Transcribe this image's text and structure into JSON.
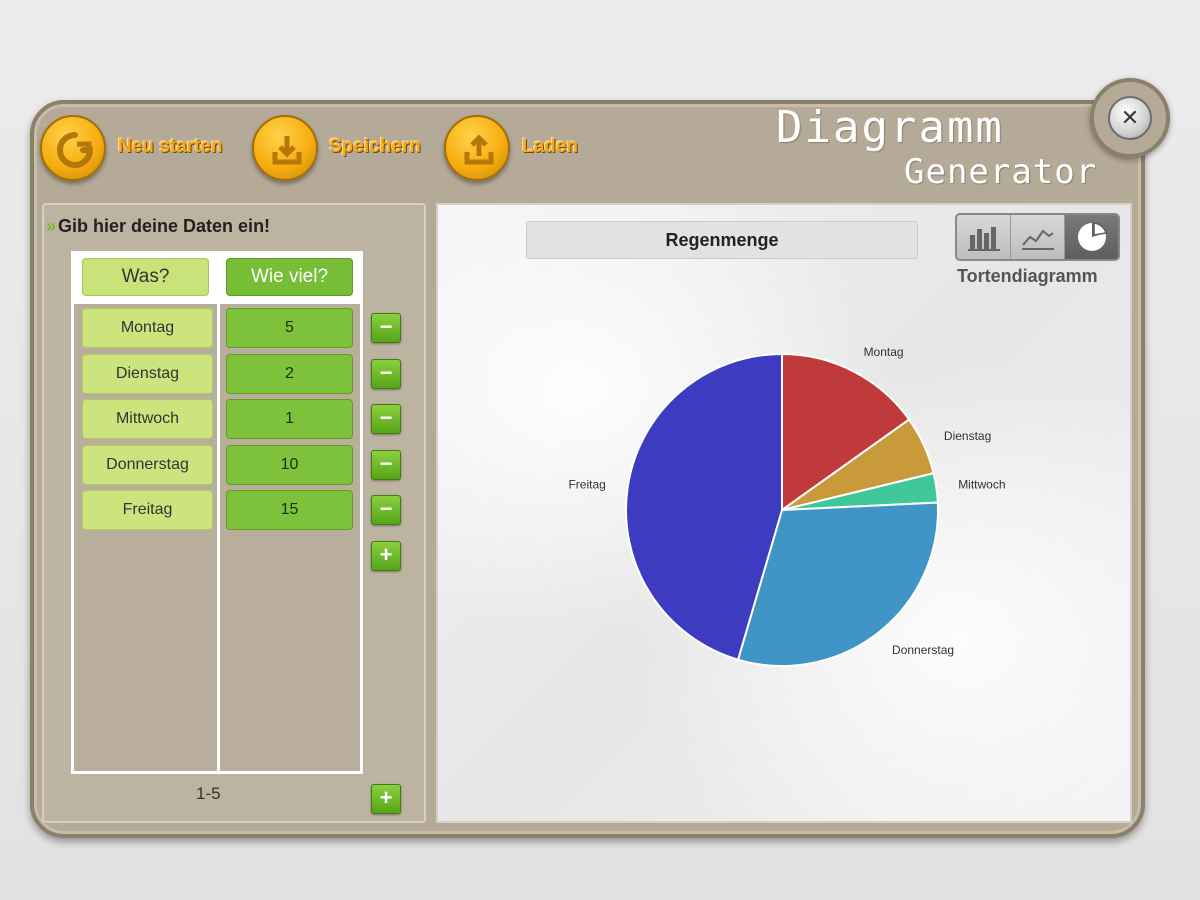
{
  "toolbar": {
    "restart_label": "Neu starten",
    "save_label": "Speichern",
    "load_label": "Laden",
    "close_symbol": "✕"
  },
  "app": {
    "title": "Diagramm",
    "subtitle": "Generator"
  },
  "data_panel": {
    "instruction": "Gib hier deine Daten ein!",
    "instruction_arrow": "»",
    "col_what": "Was?",
    "col_howmuch": "Wie viel?",
    "rows": [
      {
        "what": "Montag",
        "value": "5"
      },
      {
        "what": "Dienstag",
        "value": "2"
      },
      {
        "what": "Mittwoch",
        "value": "1"
      },
      {
        "what": "Donnerstag",
        "value": "10"
      },
      {
        "what": "Freitag",
        "value": "15"
      }
    ],
    "remove_symbol": "−",
    "add_symbol": "+",
    "pager": "1-5"
  },
  "chart_panel": {
    "title": "Regenmenge",
    "type_label": "Tortendiagramm",
    "type_icons": [
      "bar-chart-icon",
      "line-chart-icon",
      "pie-chart-icon"
    ],
    "active_type": "pie"
  },
  "chart_data": {
    "type": "pie",
    "title": "Regenmenge",
    "categories": [
      "Montag",
      "Dienstag",
      "Mittwoch",
      "Donnerstag",
      "Freitag"
    ],
    "values": [
      5,
      2,
      1,
      10,
      15
    ],
    "colors": [
      "#c0393b",
      "#c99a3a",
      "#3fc79a",
      "#3e95c6",
      "#3d3bc0"
    ]
  },
  "colors": {
    "accent_orange": "#f7ae10",
    "accent_green": "#7dc23a",
    "frame": "#b5aa97"
  }
}
